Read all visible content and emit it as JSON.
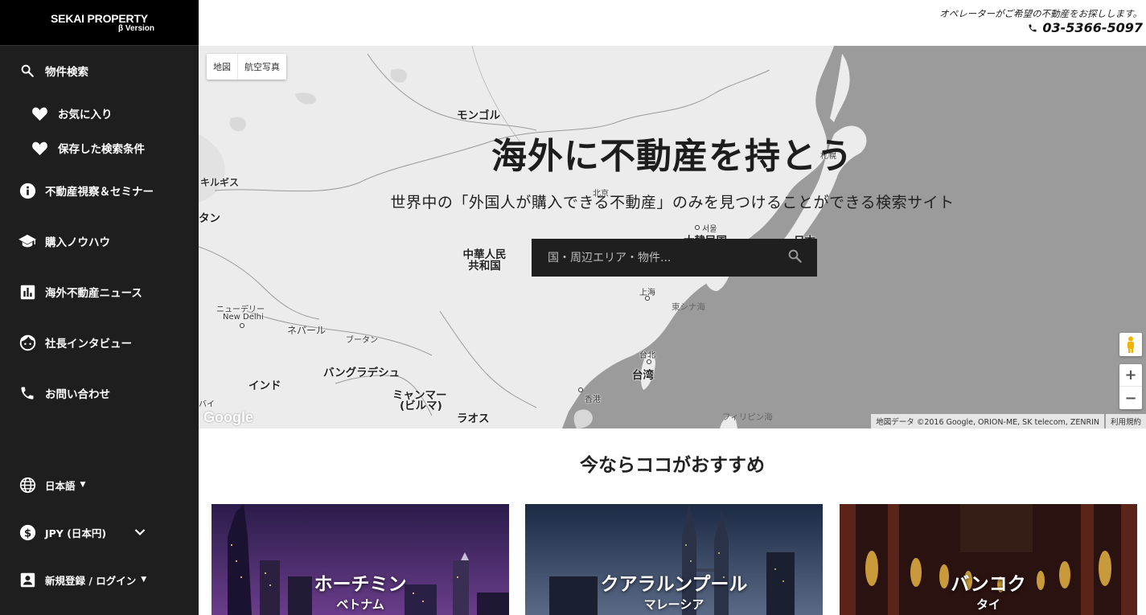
{
  "brand": {
    "name": "SEKAI PROPERTY",
    "version": "β Version"
  },
  "header": {
    "tagline": "オペレーターがご希望の不動産をお探しします。",
    "phone": "03-5366-5097"
  },
  "sidebar": {
    "items": [
      {
        "label": "物件検索",
        "icon": "search-icon"
      },
      {
        "label": "お気に入り",
        "icon": "heart-icon"
      },
      {
        "label": "保存した検索条件",
        "icon": "heart-icon"
      },
      {
        "label": "不動産視察＆セミナー",
        "icon": "info-icon"
      },
      {
        "label": "購入ノウハウ",
        "icon": "graduation-cap-icon"
      },
      {
        "label": "海外不動産ニュース",
        "icon": "bar-chart-icon"
      },
      {
        "label": "社長インタビュー",
        "icon": "face-icon"
      },
      {
        "label": "お問い合わせ",
        "icon": "phone-icon"
      }
    ],
    "language": {
      "label": "日本語",
      "icon": "globe-icon"
    },
    "currency": {
      "label": "JPY (日本円)",
      "icon": "dollar-icon"
    },
    "account": {
      "label": "新規登録 / ログイン",
      "icon": "account-icon"
    }
  },
  "map": {
    "type_buttons": [
      "地図",
      "航空写真"
    ],
    "labels": {
      "mongolia": "モンゴル",
      "kyrgyz": "キルギス",
      "tan": "タン",
      "china": "中華人民共和国",
      "korea": "大韓民国",
      "seoul": "서울",
      "beijing": "北京",
      "japan": "日本",
      "shanghai": "上海",
      "east_china_sea": "東シナ海",
      "new_delhi_jp": "ニューデリー",
      "new_delhi": "New Delhi",
      "nepal": "ネパール",
      "bhutan": "ブータン",
      "india": "インド",
      "bangladesh": "バングラデシュ",
      "myanmar": "ミャンマー",
      "myanmar2": "(ビルマ)",
      "laos": "ラオス",
      "taipei": "台北",
      "taiwan": "台湾",
      "hongkong": "香港",
      "philippine_sea": "フィリピン海",
      "bai": "バイ",
      "sapporo": "札幌"
    },
    "attribution": "地図データ ©2016 Google, ORION-ME, SK telecom, ZENRIN",
    "terms": "利用規約",
    "zoom_in": "+",
    "zoom_out": "−",
    "google": "Google"
  },
  "hero": {
    "title": "海外に不動産を持とう",
    "subtitle": "世界中の「外国人が購入できる不動産」のみを見つけることができる検索サイト",
    "search_placeholder": "国・周辺エリア・物件..."
  },
  "recommend": {
    "title": "今ならココがおすすめ",
    "cards": [
      {
        "city": "ホーチミン",
        "country": "ベトナム"
      },
      {
        "city": "クアラルンプール",
        "country": "マレーシア"
      },
      {
        "city": "バンコク",
        "country": "タイ"
      }
    ]
  },
  "colors": {
    "sidebar": "#1e1e1e",
    "logo_bg": "#000000",
    "search_bg": "#1f1f1f",
    "sea": "#9b9b9b",
    "land": "#ececec"
  }
}
